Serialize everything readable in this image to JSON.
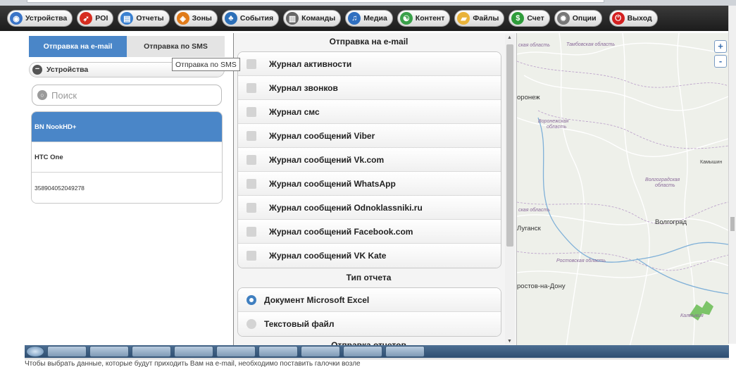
{
  "toolbar": {
    "items": [
      {
        "label": "Устройства",
        "icon": "eye-icon",
        "color": "#3a74c7"
      },
      {
        "label": "POI",
        "icon": "pin-icon",
        "color": "#d62d20"
      },
      {
        "label": "Отчеты",
        "icon": "report-icon",
        "color": "#3a80d0"
      },
      {
        "label": "Зоны",
        "icon": "zone-icon",
        "color": "#e07b1a"
      },
      {
        "label": "События",
        "icon": "events-icon",
        "color": "#2c6fb8"
      },
      {
        "label": "Команды",
        "icon": "commands-icon",
        "color": "#666666"
      },
      {
        "label": "Медиа",
        "icon": "media-icon",
        "color": "#2f6fc0"
      },
      {
        "label": "Контент",
        "icon": "content-icon",
        "color": "#3aa14a"
      },
      {
        "label": "Файлы",
        "icon": "folder-icon",
        "color": "#e9b33a"
      },
      {
        "label": "Счет",
        "icon": "money-icon",
        "color": "#2e9c3a"
      },
      {
        "label": "Опции",
        "icon": "gear-icon",
        "color": "#777777"
      },
      {
        "label": "Выход",
        "icon": "power-icon",
        "color": "#d42020"
      }
    ]
  },
  "left": {
    "tabs": {
      "email": "Отправка на e-mail",
      "sms": "Отправка по SMS"
    },
    "devices_label": "Устройства",
    "tooltip": "Отправка по SMS",
    "search_placeholder": "Поиск",
    "devices": [
      "BN NookHD+",
      "HTC One",
      "358904052049278"
    ],
    "selected_device": "BN NookHD+"
  },
  "center": {
    "email_title": "Отправка на e-mail",
    "logs": [
      "Журнал активности",
      "Журнал звонков",
      "Журнал смс",
      "Журнал сообщений Viber",
      "Журнал сообщений Vk.com",
      "Журнал сообщений WhatsApp",
      "Журнал сообщений Odnoklassniki.ru",
      "Журнал сообщений Facebook.com",
      "Журнал сообщений VK Kate"
    ],
    "report_type_title": "Тип отчета",
    "report_types": [
      "Документ Microsoft Excel",
      "Текстовый файл"
    ],
    "selected_report_type": "Документ Microsoft Excel",
    "next_title": "Отправка отчетов"
  },
  "map": {
    "labels": {
      "oblast_top": "ская область",
      "tambov": "Тамбовская область",
      "voronezh": "оронеж",
      "voronezh_obl_1": "Воронежская",
      "voronezh_obl_2": "область",
      "kamyshin": "Камышин",
      "volgograd_obl_1": "Волгоградская",
      "volgograd_obl_2": "область",
      "oblast_mid": "ская область",
      "lugansk": "Луганск",
      "volgograd": "Волгоград",
      "rostov_obl": "Ростовская область",
      "rostov": "ростов-на-Дону",
      "kalmykia": "Калмыкия"
    },
    "zoom_in": "+",
    "zoom_out": "-"
  },
  "status_hint": "Чтобы выбрать данные, которые будут приходить Вам на e-mail, необходимо поставить галочки возле"
}
